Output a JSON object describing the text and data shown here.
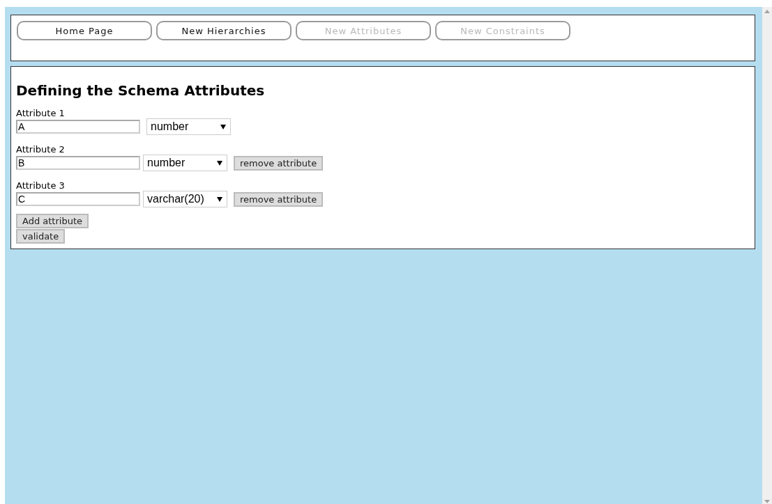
{
  "nav": [
    {
      "label": "Home Page",
      "disabled": false
    },
    {
      "label": "New Hierarchies",
      "disabled": false
    },
    {
      "label": "New Attributes",
      "disabled": true
    },
    {
      "label": "New Constraints",
      "disabled": true
    }
  ],
  "heading": "Defining the Schema Attributes",
  "attributes": [
    {
      "label": "Attribute 1",
      "value": "A",
      "type": "number"
    },
    {
      "label": "Attribute 2",
      "value": "B",
      "type": "number",
      "remove_button": "remove attribute"
    },
    {
      "label": "Attribute 3",
      "value": "C",
      "type": "varchar(20)",
      "remove_button": "remove attribute"
    }
  ],
  "add_button": "Add attribute",
  "validate_button": "validate"
}
